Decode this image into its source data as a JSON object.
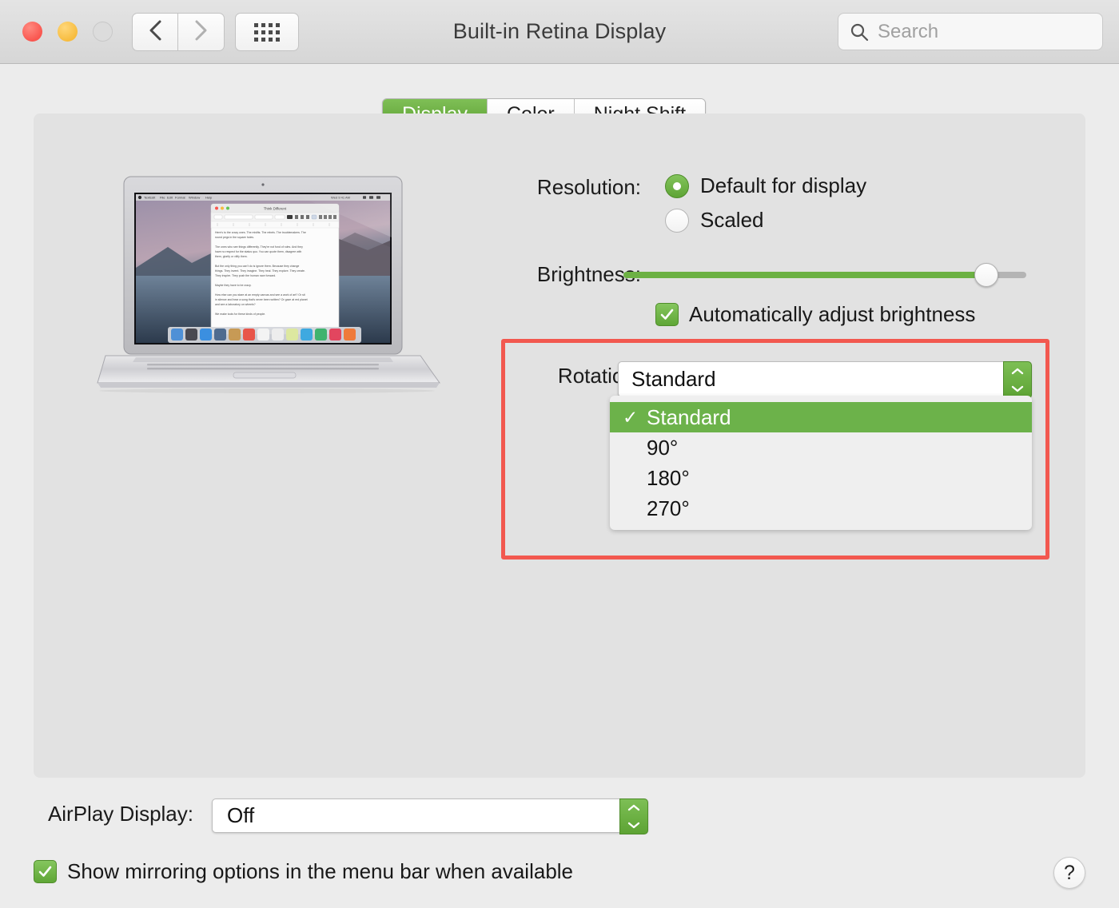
{
  "window": {
    "title": "Built-in Retina Display",
    "traffic_lights": [
      "close",
      "minimize",
      "zoom"
    ],
    "nav_back_icon": "chevron-left-icon",
    "nav_forward_icon": "chevron-right-icon",
    "grid_icon": "show-all-grid-icon"
  },
  "search": {
    "placeholder": "Search",
    "value": "",
    "icon": "search-icon"
  },
  "tabs": [
    {
      "label": "Display",
      "active": true
    },
    {
      "label": "Color",
      "active": false
    },
    {
      "label": "Night Shift",
      "active": false
    }
  ],
  "preview": {
    "device": "MacBook Pro",
    "document_title": "Think Different",
    "menu_items": [
      "TextEdit",
      "File",
      "Edit",
      "Format",
      "Window",
      "Help"
    ],
    "document_text": [
      "Here's to the crazy ones. The misfits. The rebels. The troublemakers. The round pegs in the square holes.",
      "The ones who see things differently. They're not fond of rules. And they have no respect for the status quo. You can quote them, disagree with them, glorify or vilify them.",
      "But the only thing you can't do is ignore them. Because they change things. They invent. They imagine. They heal. They explore. They create. They inspire. They push the human race forward.",
      "Maybe they have to be crazy.",
      "How else can you stare at an empty canvas and see a work of art? Or sit in silence and hear a song that's never been written? Or gaze at red planet and see a laboratory on wheels?",
      "We make tools for these kinds of people."
    ]
  },
  "resolution": {
    "label": "Resolution:",
    "options": [
      {
        "label": "Default for display",
        "selected": true
      },
      {
        "label": "Scaled",
        "selected": false
      }
    ]
  },
  "brightness": {
    "label": "Brightness:",
    "value_percent": 90,
    "auto_adjust": {
      "label": "Automatically adjust brightness",
      "checked": true
    }
  },
  "rotation": {
    "label": "Rotation:",
    "value": "Standard",
    "highlighted": true,
    "highlight_color": "#f2584f",
    "menu_open": true,
    "options": [
      {
        "label": "Standard",
        "selected": true
      },
      {
        "label": "90°",
        "selected": false
      },
      {
        "label": "180°",
        "selected": false
      },
      {
        "label": "270°",
        "selected": false
      }
    ]
  },
  "airplay": {
    "label": "AirPlay Display:",
    "value": "Off",
    "options": [
      "Off"
    ]
  },
  "mirroring": {
    "label": "Show mirroring options in the menu bar when available",
    "checked": true
  },
  "help": {
    "label": "?"
  },
  "colors": {
    "accent_green": "#6cb24a",
    "tab_active_green": "#5e9f33",
    "highlight_red": "#f2584f",
    "window_bg": "#ececec",
    "panel_bg": "#e2e2e2"
  }
}
